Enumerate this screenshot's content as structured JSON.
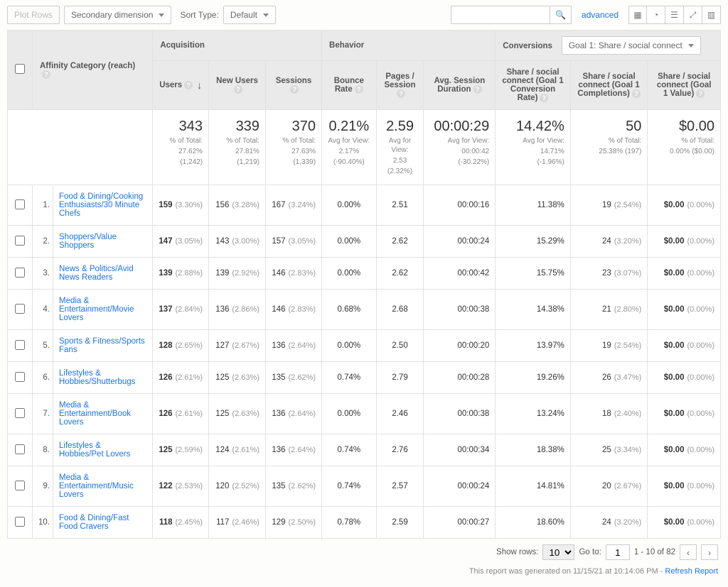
{
  "toolbar": {
    "plot_rows": "Plot Rows",
    "secondary_dimension": "Secondary dimension",
    "sort_type_label": "Sort Type:",
    "sort_type_value": "Default",
    "advanced": "advanced"
  },
  "goal_selector": "Goal 1: Share / social connect",
  "groups": {
    "dimension": "Affinity Category (reach)",
    "acquisition": "Acquisition",
    "behavior": "Behavior",
    "conversions": "Conversions"
  },
  "columns": {
    "users": "Users",
    "new_users": "New Users",
    "sessions": "Sessions",
    "bounce": "Bounce Rate",
    "pages": "Pages / Session",
    "duration": "Avg. Session Duration",
    "conv_rate": "Share / social connect (Goal 1 Conversion Rate)",
    "completions": "Share / social connect (Goal 1 Completions)",
    "value": "Share / social connect (Goal 1 Value)"
  },
  "totals": {
    "users": {
      "big": "343",
      "sub1": "% of Total:",
      "sub2": "27.62%",
      "sub3": "(1,242)"
    },
    "new_users": {
      "big": "339",
      "sub1": "% of Total:",
      "sub2": "27.81%",
      "sub3": "(1,219)"
    },
    "sessions": {
      "big": "370",
      "sub1": "% of Total:",
      "sub2": "27.63%",
      "sub3": "(1,339)"
    },
    "bounce": {
      "big": "0.21%",
      "sub1": "Avg for View:",
      "sub2": "2.17%",
      "sub3": "(-90.40%)"
    },
    "pages": {
      "big": "2.59",
      "sub1": "Avg for View:",
      "sub2": "2.53",
      "sub3": "(2.32%)"
    },
    "duration": {
      "big": "00:00:29",
      "sub1": "Avg for View:",
      "sub2": "00:00:42",
      "sub3": "(-30.22%)"
    },
    "conv_rate": {
      "big": "14.42%",
      "sub1": "Avg for View:",
      "sub2": "14.71%",
      "sub3": "(-1.96%)"
    },
    "completions": {
      "big": "50",
      "sub1": "% of Total:",
      "sub2": "25.38% (197)",
      "sub3": ""
    },
    "value": {
      "big": "$0.00",
      "sub1": "% of Total:",
      "sub2": "0.00% ($0.00)",
      "sub3": ""
    }
  },
  "rows": [
    {
      "idx": "1.",
      "name": "Food & Dining/Cooking Enthusiasts/30 Minute Chefs",
      "users": "159",
      "users_pct": "(3.30%)",
      "new": "156",
      "new_pct": "(3.28%)",
      "sess": "167",
      "sess_pct": "(3.24%)",
      "bounce": "0.00%",
      "pages": "2.51",
      "dur": "00:00:16",
      "conv": "11.38%",
      "comp": "19",
      "comp_pct": "(2.54%)",
      "val": "$0.00",
      "val_pct": "(0.00%)"
    },
    {
      "idx": "2.",
      "name": "Shoppers/Value Shoppers",
      "users": "147",
      "users_pct": "(3.05%)",
      "new": "143",
      "new_pct": "(3.00%)",
      "sess": "157",
      "sess_pct": "(3.05%)",
      "bounce": "0.00%",
      "pages": "2.62",
      "dur": "00:00:24",
      "conv": "15.29%",
      "comp": "24",
      "comp_pct": "(3.20%)",
      "val": "$0.00",
      "val_pct": "(0.00%)"
    },
    {
      "idx": "3.",
      "name": "News & Politics/Avid News Readers",
      "users": "139",
      "users_pct": "(2.88%)",
      "new": "139",
      "new_pct": "(2.92%)",
      "sess": "146",
      "sess_pct": "(2.83%)",
      "bounce": "0.00%",
      "pages": "2.62",
      "dur": "00:00:42",
      "conv": "15.75%",
      "comp": "23",
      "comp_pct": "(3.07%)",
      "val": "$0.00",
      "val_pct": "(0.00%)"
    },
    {
      "idx": "4.",
      "name": "Media & Entertainment/Movie Lovers",
      "users": "137",
      "users_pct": "(2.84%)",
      "new": "136",
      "new_pct": "(2.86%)",
      "sess": "146",
      "sess_pct": "(2.83%)",
      "bounce": "0.68%",
      "pages": "2.68",
      "dur": "00:00:38",
      "conv": "14.38%",
      "comp": "21",
      "comp_pct": "(2.80%)",
      "val": "$0.00",
      "val_pct": "(0.00%)"
    },
    {
      "idx": "5.",
      "name": "Sports & Fitness/Sports Fans",
      "users": "128",
      "users_pct": "(2.65%)",
      "new": "127",
      "new_pct": "(2.67%)",
      "sess": "136",
      "sess_pct": "(2.64%)",
      "bounce": "0.00%",
      "pages": "2.50",
      "dur": "00:00:20",
      "conv": "13.97%",
      "comp": "19",
      "comp_pct": "(2.54%)",
      "val": "$0.00",
      "val_pct": "(0.00%)"
    },
    {
      "idx": "6.",
      "name": "Lifestyles & Hobbies/Shutterbugs",
      "users": "126",
      "users_pct": "(2.61%)",
      "new": "125",
      "new_pct": "(2.63%)",
      "sess": "135",
      "sess_pct": "(2.62%)",
      "bounce": "0.74%",
      "pages": "2.79",
      "dur": "00:00:28",
      "conv": "19.26%",
      "comp": "26",
      "comp_pct": "(3.47%)",
      "val": "$0.00",
      "val_pct": "(0.00%)"
    },
    {
      "idx": "7.",
      "name": "Media & Entertainment/Book Lovers",
      "users": "126",
      "users_pct": "(2.61%)",
      "new": "125",
      "new_pct": "(2.63%)",
      "sess": "136",
      "sess_pct": "(2.64%)",
      "bounce": "0.00%",
      "pages": "2.46",
      "dur": "00:00:38",
      "conv": "13.24%",
      "comp": "18",
      "comp_pct": "(2.40%)",
      "val": "$0.00",
      "val_pct": "(0.00%)"
    },
    {
      "idx": "8.",
      "name": "Lifestyles & Hobbies/Pet Lovers",
      "users": "125",
      "users_pct": "(2.59%)",
      "new": "124",
      "new_pct": "(2.61%)",
      "sess": "136",
      "sess_pct": "(2.64%)",
      "bounce": "0.74%",
      "pages": "2.76",
      "dur": "00:00:34",
      "conv": "18.38%",
      "comp": "25",
      "comp_pct": "(3.34%)",
      "val": "$0.00",
      "val_pct": "(0.00%)"
    },
    {
      "idx": "9.",
      "name": "Media & Entertainment/Music Lovers",
      "users": "122",
      "users_pct": "(2.53%)",
      "new": "120",
      "new_pct": "(2.52%)",
      "sess": "135",
      "sess_pct": "(2.62%)",
      "bounce": "0.74%",
      "pages": "2.57",
      "dur": "00:00:24",
      "conv": "14.81%",
      "comp": "20",
      "comp_pct": "(2.67%)",
      "val": "$0.00",
      "val_pct": "(0.00%)"
    },
    {
      "idx": "10.",
      "name": "Food & Dining/Fast Food Cravers",
      "users": "118",
      "users_pct": "(2.45%)",
      "new": "117",
      "new_pct": "(2.46%)",
      "sess": "129",
      "sess_pct": "(2.50%)",
      "bounce": "0.78%",
      "pages": "2.59",
      "dur": "00:00:27",
      "conv": "18.60%",
      "comp": "24",
      "comp_pct": "(3.20%)",
      "val": "$0.00",
      "val_pct": "(0.00%)"
    }
  ],
  "footer": {
    "show_rows": "Show rows:",
    "rows_value": "10",
    "goto": "Go to:",
    "goto_value": "1",
    "range": "1 - 10 of 82"
  },
  "generated": {
    "text": "This report was generated on 11/15/21 at 10:14:06 PM - ",
    "refresh": "Refresh Report"
  }
}
